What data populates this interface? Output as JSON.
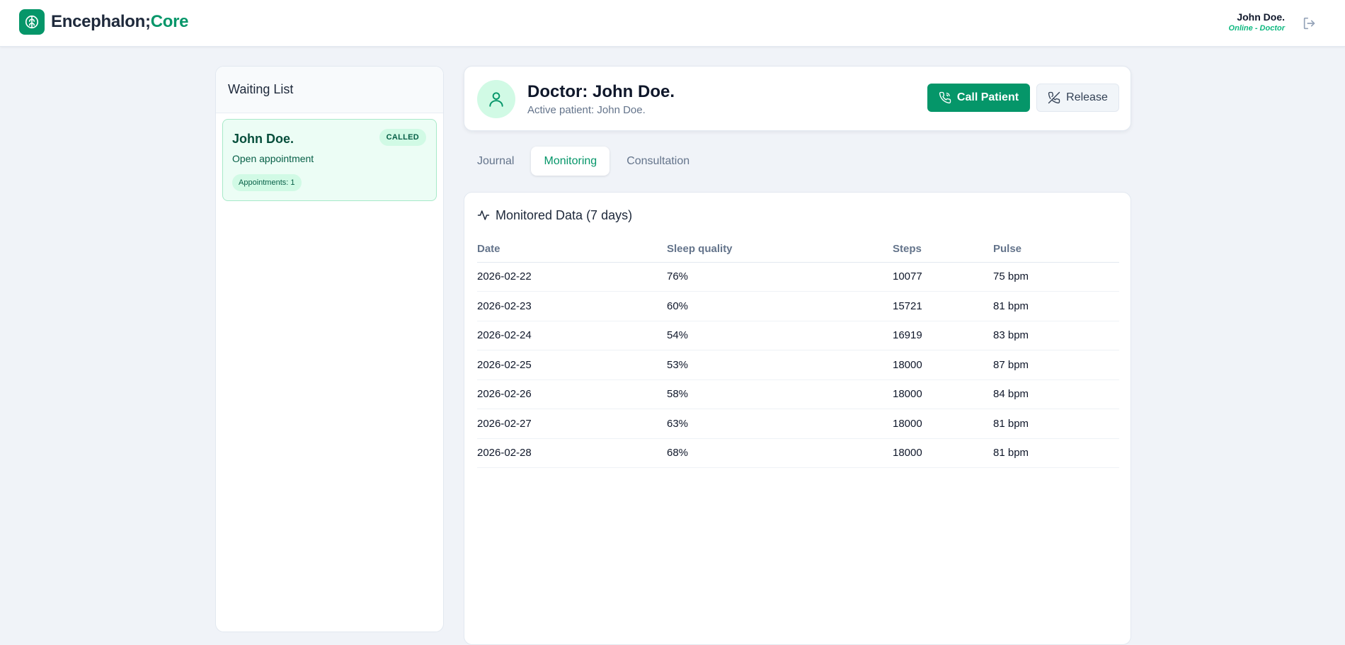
{
  "header": {
    "brand_part1": "Encephalon;",
    "brand_part2": "Core",
    "user_name": "John Doe.",
    "user_status": "Online - Doctor",
    "logo_icon": "brain-icon",
    "logout_icon": "logout-icon"
  },
  "waiting_list": {
    "title": "Waiting List",
    "items": [
      {
        "name": "John Doe.",
        "badge": "CALLED",
        "subtitle": "Open appointment",
        "count": "Appointments: 1"
      }
    ]
  },
  "doctor": {
    "title": "Doctor: John Doe.",
    "subtitle": "Active patient: John Doe.",
    "call_label": "Call Patient",
    "release_label": "Release",
    "avatar_icon": "user-icon"
  },
  "tabs": [
    {
      "label": "Journal",
      "active": false
    },
    {
      "label": "Monitoring",
      "active": true
    },
    {
      "label": "Consultation",
      "active": false
    }
  ],
  "monitoring": {
    "title": "Monitored Data (7 days)",
    "columns": [
      "Date",
      "Sleep quality",
      "Steps",
      "Pulse"
    ],
    "rows": [
      [
        "2026-02-22",
        "76%",
        "10077",
        "75 bpm"
      ],
      [
        "2026-02-23",
        "60%",
        "15721",
        "81 bpm"
      ],
      [
        "2026-02-24",
        "54%",
        "16919",
        "83 bpm"
      ],
      [
        "2026-02-25",
        "53%",
        "18000",
        "87 bpm"
      ],
      [
        "2026-02-26",
        "58%",
        "18000",
        "84 bpm"
      ],
      [
        "2026-02-27",
        "63%",
        "18000",
        "81 bpm"
      ],
      [
        "2026-02-28",
        "68%",
        "18000",
        "81 bpm"
      ]
    ]
  },
  "colors": {
    "accent": "#059669",
    "accent_light": "#d1fae5",
    "background": "#f0f3f8"
  }
}
